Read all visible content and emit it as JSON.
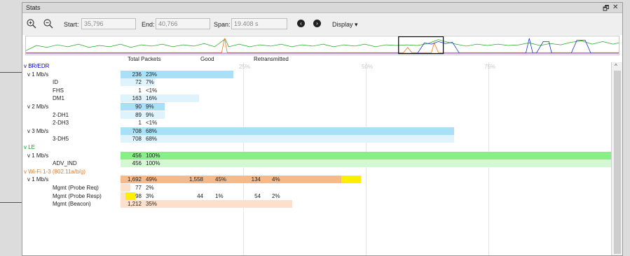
{
  "window": {
    "title": "Stats",
    "restore_icon": "restore-icon",
    "close_icon": "close-icon",
    "restore_glyph": "🗗",
    "close_glyph": "✕"
  },
  "toolbar": {
    "start_label": "Start:",
    "start_value": "35,796",
    "end_label": "End:",
    "end_value": "40,766",
    "span_label": "Span:",
    "span_value": "19.408 s",
    "display_label": "Display ▾",
    "zoom_in_icon": "zoom-in-icon",
    "zoom_out_icon": "zoom-out-icon",
    "prev_icon": "arrow-left-circle-icon",
    "next_icon": "arrow-right-circle-icon"
  },
  "columns": {
    "total": "Total Packets",
    "good": "Good",
    "retransmitted": "Retransmitted"
  },
  "scale": {
    "labels": [
      "25%",
      "50%",
      "75%"
    ]
  },
  "colors": {
    "bredr_text": "#0000cc",
    "le_text": "#00aa00",
    "wifi_text": "#e07a20",
    "blue_bar": "#a8e0f8",
    "blue_bar_light": "#dff3fc",
    "green_bar": "#88ee88",
    "green_bar_light": "#d4f8d4",
    "orange_bar": "#f6b98a",
    "orange_bar_light": "#fde0cc",
    "retrans_yellow": "#ffee00"
  },
  "rows": [
    {
      "name": "v BR/EDR",
      "indent": 0,
      "color": "bredr",
      "total": "",
      "pct": "",
      "fraction": 0
    },
    {
      "name": "v 1 Mb/s",
      "indent": 1,
      "color": "normal",
      "total": "236",
      "pct": "23%",
      "fraction": 0.23,
      "bar": "blue"
    },
    {
      "name": "ID",
      "indent": 2,
      "color": "normal",
      "total": "72",
      "pct": "7%",
      "fraction": 0.07,
      "bar": "blue_light"
    },
    {
      "name": "FHS",
      "indent": 2,
      "color": "normal",
      "total": "1",
      "pct": "<1%",
      "fraction": 0,
      "bar": "blue_light"
    },
    {
      "name": "DM1",
      "indent": 2,
      "color": "normal",
      "total": "163",
      "pct": "16%",
      "fraction": 0.16,
      "bar": "blue_light"
    },
    {
      "name": "v 2 Mb/s",
      "indent": 1,
      "color": "normal",
      "total": "90",
      "pct": "9%",
      "fraction": 0.09,
      "bar": "blue"
    },
    {
      "name": "2-DH1",
      "indent": 2,
      "color": "normal",
      "total": "89",
      "pct": "9%",
      "fraction": 0.09,
      "bar": "blue_light"
    },
    {
      "name": "2-DH3",
      "indent": 2,
      "color": "normal",
      "total": "1",
      "pct": "<1%",
      "fraction": 0,
      "bar": "blue_light"
    },
    {
      "name": "v 3 Mb/s",
      "indent": 1,
      "color": "normal",
      "total": "708",
      "pct": "68%",
      "fraction": 0.68,
      "bar": "blue"
    },
    {
      "name": "3-DH5",
      "indent": 2,
      "color": "normal",
      "total": "708",
      "pct": "68%",
      "fraction": 0.68,
      "bar": "blue_light"
    },
    {
      "name": "v LE",
      "indent": 0,
      "color": "le",
      "total": "",
      "pct": "",
      "fraction": 0
    },
    {
      "name": "v 1 Mb/s",
      "indent": 1,
      "color": "normal",
      "total": "456",
      "pct": "100%",
      "fraction": 1.0,
      "bar": "green"
    },
    {
      "name": "ADV_IND",
      "indent": 2,
      "color": "normal",
      "total": "456",
      "pct": "100%",
      "fraction": 1.0,
      "bar": "green_light"
    },
    {
      "name": "v Wi-Fi 1-3 (802.11a/b/g)",
      "indent": 0,
      "color": "wifi",
      "total": "",
      "pct": "",
      "fraction": 0
    },
    {
      "name": "v 1 Mb/s",
      "indent": 1,
      "color": "normal",
      "total": "1,692",
      "pct": "49%",
      "fraction": 0.49,
      "bar": "orange",
      "good": "1,558",
      "good_pct": "45%",
      "retrans": "134",
      "retrans_pct": "4%",
      "retrans_fraction": 0.04
    },
    {
      "name": "Mgmt (Probe Req)",
      "indent": 2,
      "color": "normal",
      "total": "77",
      "pct": "2%",
      "fraction": 0.02,
      "bar": "orange_light"
    },
    {
      "name": "Mgmt (Probe Resp)",
      "indent": 2,
      "color": "normal",
      "total": "98",
      "pct": "3%",
      "fraction": 0.03,
      "bar": "orange_light",
      "good": "44",
      "good_pct": "1%",
      "retrans": "54",
      "retrans_pct": "2%",
      "retrans_fraction": 0.02
    },
    {
      "name": "Mgmt (Beacon)",
      "indent": 2,
      "color": "normal",
      "total": "1,212",
      "pct": "35%",
      "fraction": 0.35,
      "bar": "orange_light"
    }
  ]
}
